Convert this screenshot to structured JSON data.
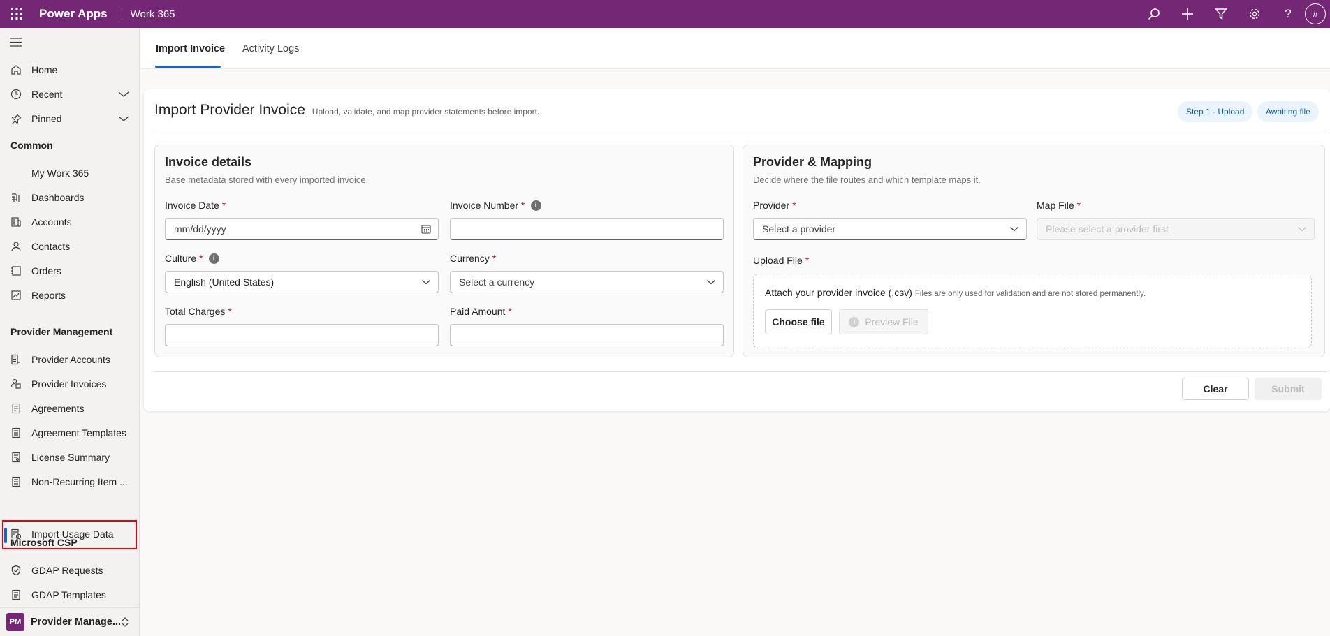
{
  "topbar": {
    "app_name": "Power Apps",
    "environment": "Work 365",
    "avatar_initial": "#",
    "color": "#742774"
  },
  "sidebar": {
    "nav_top": [
      {
        "label": "Home",
        "icon": "home-icon"
      },
      {
        "label": "Recent",
        "icon": "clock-icon",
        "expandable": true
      },
      {
        "label": "Pinned",
        "icon": "pin-icon",
        "expandable": true
      }
    ],
    "common_title": "Common",
    "common_items": [
      {
        "label": "My Work 365",
        "icon": ""
      },
      {
        "label": "Dashboards",
        "icon": "dashboard-icon"
      },
      {
        "label": "Accounts",
        "icon": "accounts-icon"
      },
      {
        "label": "Contacts",
        "icon": "contact-icon"
      },
      {
        "label": "Orders",
        "icon": "orders-icon"
      },
      {
        "label": "Reports",
        "icon": "reports-icon"
      }
    ],
    "provider_title": "Provider Management",
    "provider_items": [
      {
        "label": "Provider Accounts",
        "icon": "provider-accounts-icon"
      },
      {
        "label": "Provider Invoices",
        "icon": "provider-invoices-icon"
      },
      {
        "label": "Agreements",
        "icon": "agreements-icon"
      },
      {
        "label": "Agreement Templates",
        "icon": "agreement-templates-icon"
      },
      {
        "label": "License Summary",
        "icon": "license-summary-icon"
      },
      {
        "label": "Non-Recurring Item ...",
        "icon": "non-recurring-icon"
      },
      {
        "label": "Import Usage Data",
        "icon": "import-usage-icon",
        "selected": true
      }
    ],
    "csp_title": "Microsoft CSP",
    "csp_items": [
      {
        "label": "GDAP Requests",
        "icon": "gdap-requests-icon"
      },
      {
        "label": "GDAP Templates",
        "icon": "gdap-templates-icon"
      }
    ],
    "area_badge": "PM",
    "area_label": "Provider Manage..."
  },
  "tabs": [
    {
      "label": "Import Invoice",
      "active": true
    },
    {
      "label": "Activity Logs",
      "active": false
    }
  ],
  "header": {
    "title": "Import Provider Invoice",
    "subtitle": "Upload, validate, and map provider statements before import.",
    "step_pill": "Step 1 · Upload",
    "status_pill": "Awaiting file"
  },
  "invoice_details": {
    "title": "Invoice details",
    "subtitle": "Base metadata stored with every imported invoice.",
    "invoice_date_label": "Invoice Date",
    "invoice_date_placeholder": "mm/dd/yyyy",
    "invoice_number_label": "Invoice Number",
    "invoice_number_value": "",
    "culture_label": "Culture",
    "culture_value": "English (United States)",
    "currency_label": "Currency",
    "currency_placeholder": "Select a currency",
    "total_charges_label": "Total Charges",
    "total_charges_value": "",
    "paid_amount_label": "Paid Amount",
    "paid_amount_value": ""
  },
  "provider_mapping": {
    "title": "Provider & Mapping",
    "subtitle": "Decide where the file routes and which template maps it.",
    "provider_label": "Provider",
    "provider_placeholder": "Select a provider",
    "map_file_label": "Map File",
    "map_file_placeholder": "Please select a provider first",
    "upload_label": "Upload File",
    "attach_text": "Attach your provider invoice (.csv)",
    "attach_note": "Files are only used for validation and are not stored permanently.",
    "choose_file_label": "Choose file",
    "preview_file_label": "Preview File"
  },
  "actions": {
    "clear_label": "Clear",
    "submit_label": "Submit"
  },
  "required_mark": "*",
  "info_mark": "i"
}
